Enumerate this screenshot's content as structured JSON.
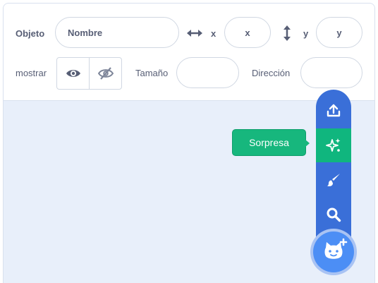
{
  "sprite_info": {
    "sprite_label": "Objeto",
    "name_placeholder": "Nombre",
    "x_label": "x",
    "x_placeholder": "x",
    "y_label": "y",
    "y_placeholder": "y",
    "show_label": "mostrar",
    "size_label": "Tamaño",
    "size_value": "",
    "direction_label": "Dirección",
    "direction_value": ""
  },
  "sprite_menu": {
    "items": [
      {
        "icon": "upload-icon"
      },
      {
        "icon": "sparkles-icon",
        "active": true
      },
      {
        "icon": "paintbrush-icon"
      },
      {
        "icon": "search-icon"
      }
    ],
    "tooltip": "Sorpresa",
    "main_icon": "cat-plus-icon"
  },
  "colors": {
    "menu_blue": "#3a6fd8",
    "active_green": "#10b67e",
    "main_button": "#4c8ef5",
    "text": "#575e75"
  }
}
